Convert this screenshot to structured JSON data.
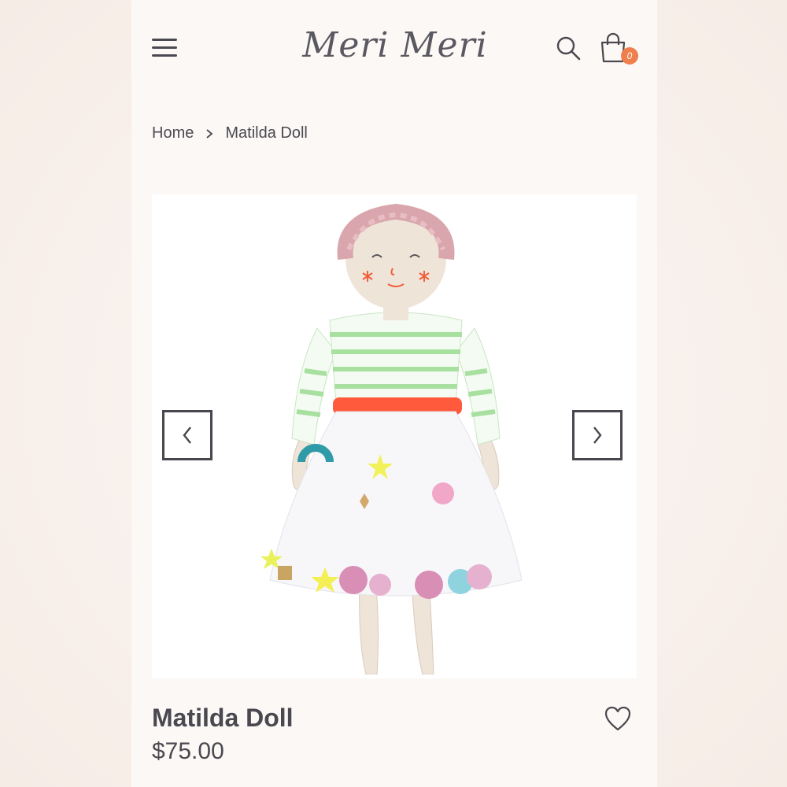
{
  "header": {
    "logo_text": "Meri Meri",
    "cart_count": "0"
  },
  "breadcrumb": {
    "home": "Home",
    "current": "Matilda Doll"
  },
  "product": {
    "title": "Matilda Doll",
    "price": "$75.00"
  },
  "icons": {
    "menu": "hamburger-menu-icon",
    "search": "search-icon",
    "cart": "shopping-bag-icon",
    "breadcrumb_separator": "chevron-right-icon",
    "prev": "chevron-left-icon",
    "next": "chevron-right-icon",
    "wishlist": "heart-outline-icon"
  },
  "colors": {
    "badge": "#ef7f4c",
    "text": "#4a4950",
    "background": "#fcf8f6"
  }
}
